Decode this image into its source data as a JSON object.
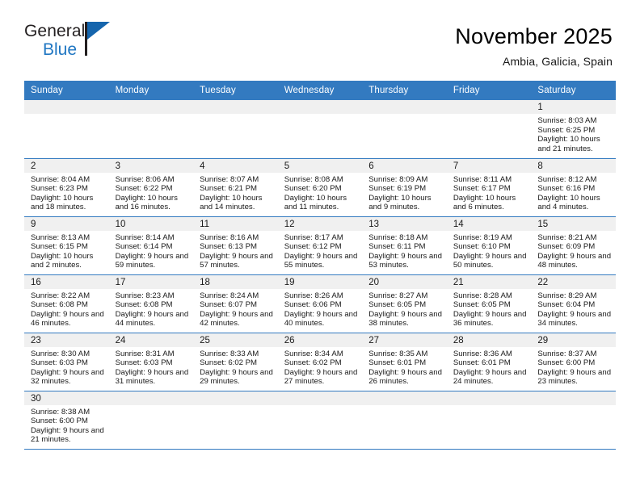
{
  "brand": {
    "name_part1": "General",
    "name_part2": "Blue",
    "flag_color": "#1565ad"
  },
  "header": {
    "title": "November 2025",
    "subtitle": "Ambia, Galicia, Spain",
    "accent_color": "#337ac0"
  },
  "weekdays": [
    "Sunday",
    "Monday",
    "Tuesday",
    "Wednesday",
    "Thursday",
    "Friday",
    "Saturday"
  ],
  "labels": {
    "sunrise": "Sunrise:",
    "sunset": "Sunset:",
    "daylight": "Daylight:"
  },
  "weeks": [
    [
      {
        "day": "",
        "blank": true
      },
      {
        "day": "",
        "blank": true
      },
      {
        "day": "",
        "blank": true
      },
      {
        "day": "",
        "blank": true
      },
      {
        "day": "",
        "blank": true
      },
      {
        "day": "",
        "blank": true
      },
      {
        "day": "1",
        "sunrise": "Sunrise: 8:03 AM",
        "sunset": "Sunset: 6:25 PM",
        "daylight": "Daylight: 10 hours and 21 minutes."
      }
    ],
    [
      {
        "day": "2",
        "sunrise": "Sunrise: 8:04 AM",
        "sunset": "Sunset: 6:23 PM",
        "daylight": "Daylight: 10 hours and 18 minutes."
      },
      {
        "day": "3",
        "sunrise": "Sunrise: 8:06 AM",
        "sunset": "Sunset: 6:22 PM",
        "daylight": "Daylight: 10 hours and 16 minutes."
      },
      {
        "day": "4",
        "sunrise": "Sunrise: 8:07 AM",
        "sunset": "Sunset: 6:21 PM",
        "daylight": "Daylight: 10 hours and 14 minutes."
      },
      {
        "day": "5",
        "sunrise": "Sunrise: 8:08 AM",
        "sunset": "Sunset: 6:20 PM",
        "daylight": "Daylight: 10 hours and 11 minutes."
      },
      {
        "day": "6",
        "sunrise": "Sunrise: 8:09 AM",
        "sunset": "Sunset: 6:19 PM",
        "daylight": "Daylight: 10 hours and 9 minutes."
      },
      {
        "day": "7",
        "sunrise": "Sunrise: 8:11 AM",
        "sunset": "Sunset: 6:17 PM",
        "daylight": "Daylight: 10 hours and 6 minutes."
      },
      {
        "day": "8",
        "sunrise": "Sunrise: 8:12 AM",
        "sunset": "Sunset: 6:16 PM",
        "daylight": "Daylight: 10 hours and 4 minutes."
      }
    ],
    [
      {
        "day": "9",
        "sunrise": "Sunrise: 8:13 AM",
        "sunset": "Sunset: 6:15 PM",
        "daylight": "Daylight: 10 hours and 2 minutes."
      },
      {
        "day": "10",
        "sunrise": "Sunrise: 8:14 AM",
        "sunset": "Sunset: 6:14 PM",
        "daylight": "Daylight: 9 hours and 59 minutes."
      },
      {
        "day": "11",
        "sunrise": "Sunrise: 8:16 AM",
        "sunset": "Sunset: 6:13 PM",
        "daylight": "Daylight: 9 hours and 57 minutes."
      },
      {
        "day": "12",
        "sunrise": "Sunrise: 8:17 AM",
        "sunset": "Sunset: 6:12 PM",
        "daylight": "Daylight: 9 hours and 55 minutes."
      },
      {
        "day": "13",
        "sunrise": "Sunrise: 8:18 AM",
        "sunset": "Sunset: 6:11 PM",
        "daylight": "Daylight: 9 hours and 53 minutes."
      },
      {
        "day": "14",
        "sunrise": "Sunrise: 8:19 AM",
        "sunset": "Sunset: 6:10 PM",
        "daylight": "Daylight: 9 hours and 50 minutes."
      },
      {
        "day": "15",
        "sunrise": "Sunrise: 8:21 AM",
        "sunset": "Sunset: 6:09 PM",
        "daylight": "Daylight: 9 hours and 48 minutes."
      }
    ],
    [
      {
        "day": "16",
        "sunrise": "Sunrise: 8:22 AM",
        "sunset": "Sunset: 6:08 PM",
        "daylight": "Daylight: 9 hours and 46 minutes."
      },
      {
        "day": "17",
        "sunrise": "Sunrise: 8:23 AM",
        "sunset": "Sunset: 6:08 PM",
        "daylight": "Daylight: 9 hours and 44 minutes."
      },
      {
        "day": "18",
        "sunrise": "Sunrise: 8:24 AM",
        "sunset": "Sunset: 6:07 PM",
        "daylight": "Daylight: 9 hours and 42 minutes."
      },
      {
        "day": "19",
        "sunrise": "Sunrise: 8:26 AM",
        "sunset": "Sunset: 6:06 PM",
        "daylight": "Daylight: 9 hours and 40 minutes."
      },
      {
        "day": "20",
        "sunrise": "Sunrise: 8:27 AM",
        "sunset": "Sunset: 6:05 PM",
        "daylight": "Daylight: 9 hours and 38 minutes."
      },
      {
        "day": "21",
        "sunrise": "Sunrise: 8:28 AM",
        "sunset": "Sunset: 6:05 PM",
        "daylight": "Daylight: 9 hours and 36 minutes."
      },
      {
        "day": "22",
        "sunrise": "Sunrise: 8:29 AM",
        "sunset": "Sunset: 6:04 PM",
        "daylight": "Daylight: 9 hours and 34 minutes."
      }
    ],
    [
      {
        "day": "23",
        "sunrise": "Sunrise: 8:30 AM",
        "sunset": "Sunset: 6:03 PM",
        "daylight": "Daylight: 9 hours and 32 minutes."
      },
      {
        "day": "24",
        "sunrise": "Sunrise: 8:31 AM",
        "sunset": "Sunset: 6:03 PM",
        "daylight": "Daylight: 9 hours and 31 minutes."
      },
      {
        "day": "25",
        "sunrise": "Sunrise: 8:33 AM",
        "sunset": "Sunset: 6:02 PM",
        "daylight": "Daylight: 9 hours and 29 minutes."
      },
      {
        "day": "26",
        "sunrise": "Sunrise: 8:34 AM",
        "sunset": "Sunset: 6:02 PM",
        "daylight": "Daylight: 9 hours and 27 minutes."
      },
      {
        "day": "27",
        "sunrise": "Sunrise: 8:35 AM",
        "sunset": "Sunset: 6:01 PM",
        "daylight": "Daylight: 9 hours and 26 minutes."
      },
      {
        "day": "28",
        "sunrise": "Sunrise: 8:36 AM",
        "sunset": "Sunset: 6:01 PM",
        "daylight": "Daylight: 9 hours and 24 minutes."
      },
      {
        "day": "29",
        "sunrise": "Sunrise: 8:37 AM",
        "sunset": "Sunset: 6:00 PM",
        "daylight": "Daylight: 9 hours and 23 minutes."
      }
    ],
    [
      {
        "day": "30",
        "sunrise": "Sunrise: 8:38 AM",
        "sunset": "Sunset: 6:00 PM",
        "daylight": "Daylight: 9 hours and 21 minutes."
      },
      {
        "day": "",
        "blank": true
      },
      {
        "day": "",
        "blank": true
      },
      {
        "day": "",
        "blank": true
      },
      {
        "day": "",
        "blank": true
      },
      {
        "day": "",
        "blank": true
      },
      {
        "day": "",
        "blank": true
      }
    ]
  ]
}
